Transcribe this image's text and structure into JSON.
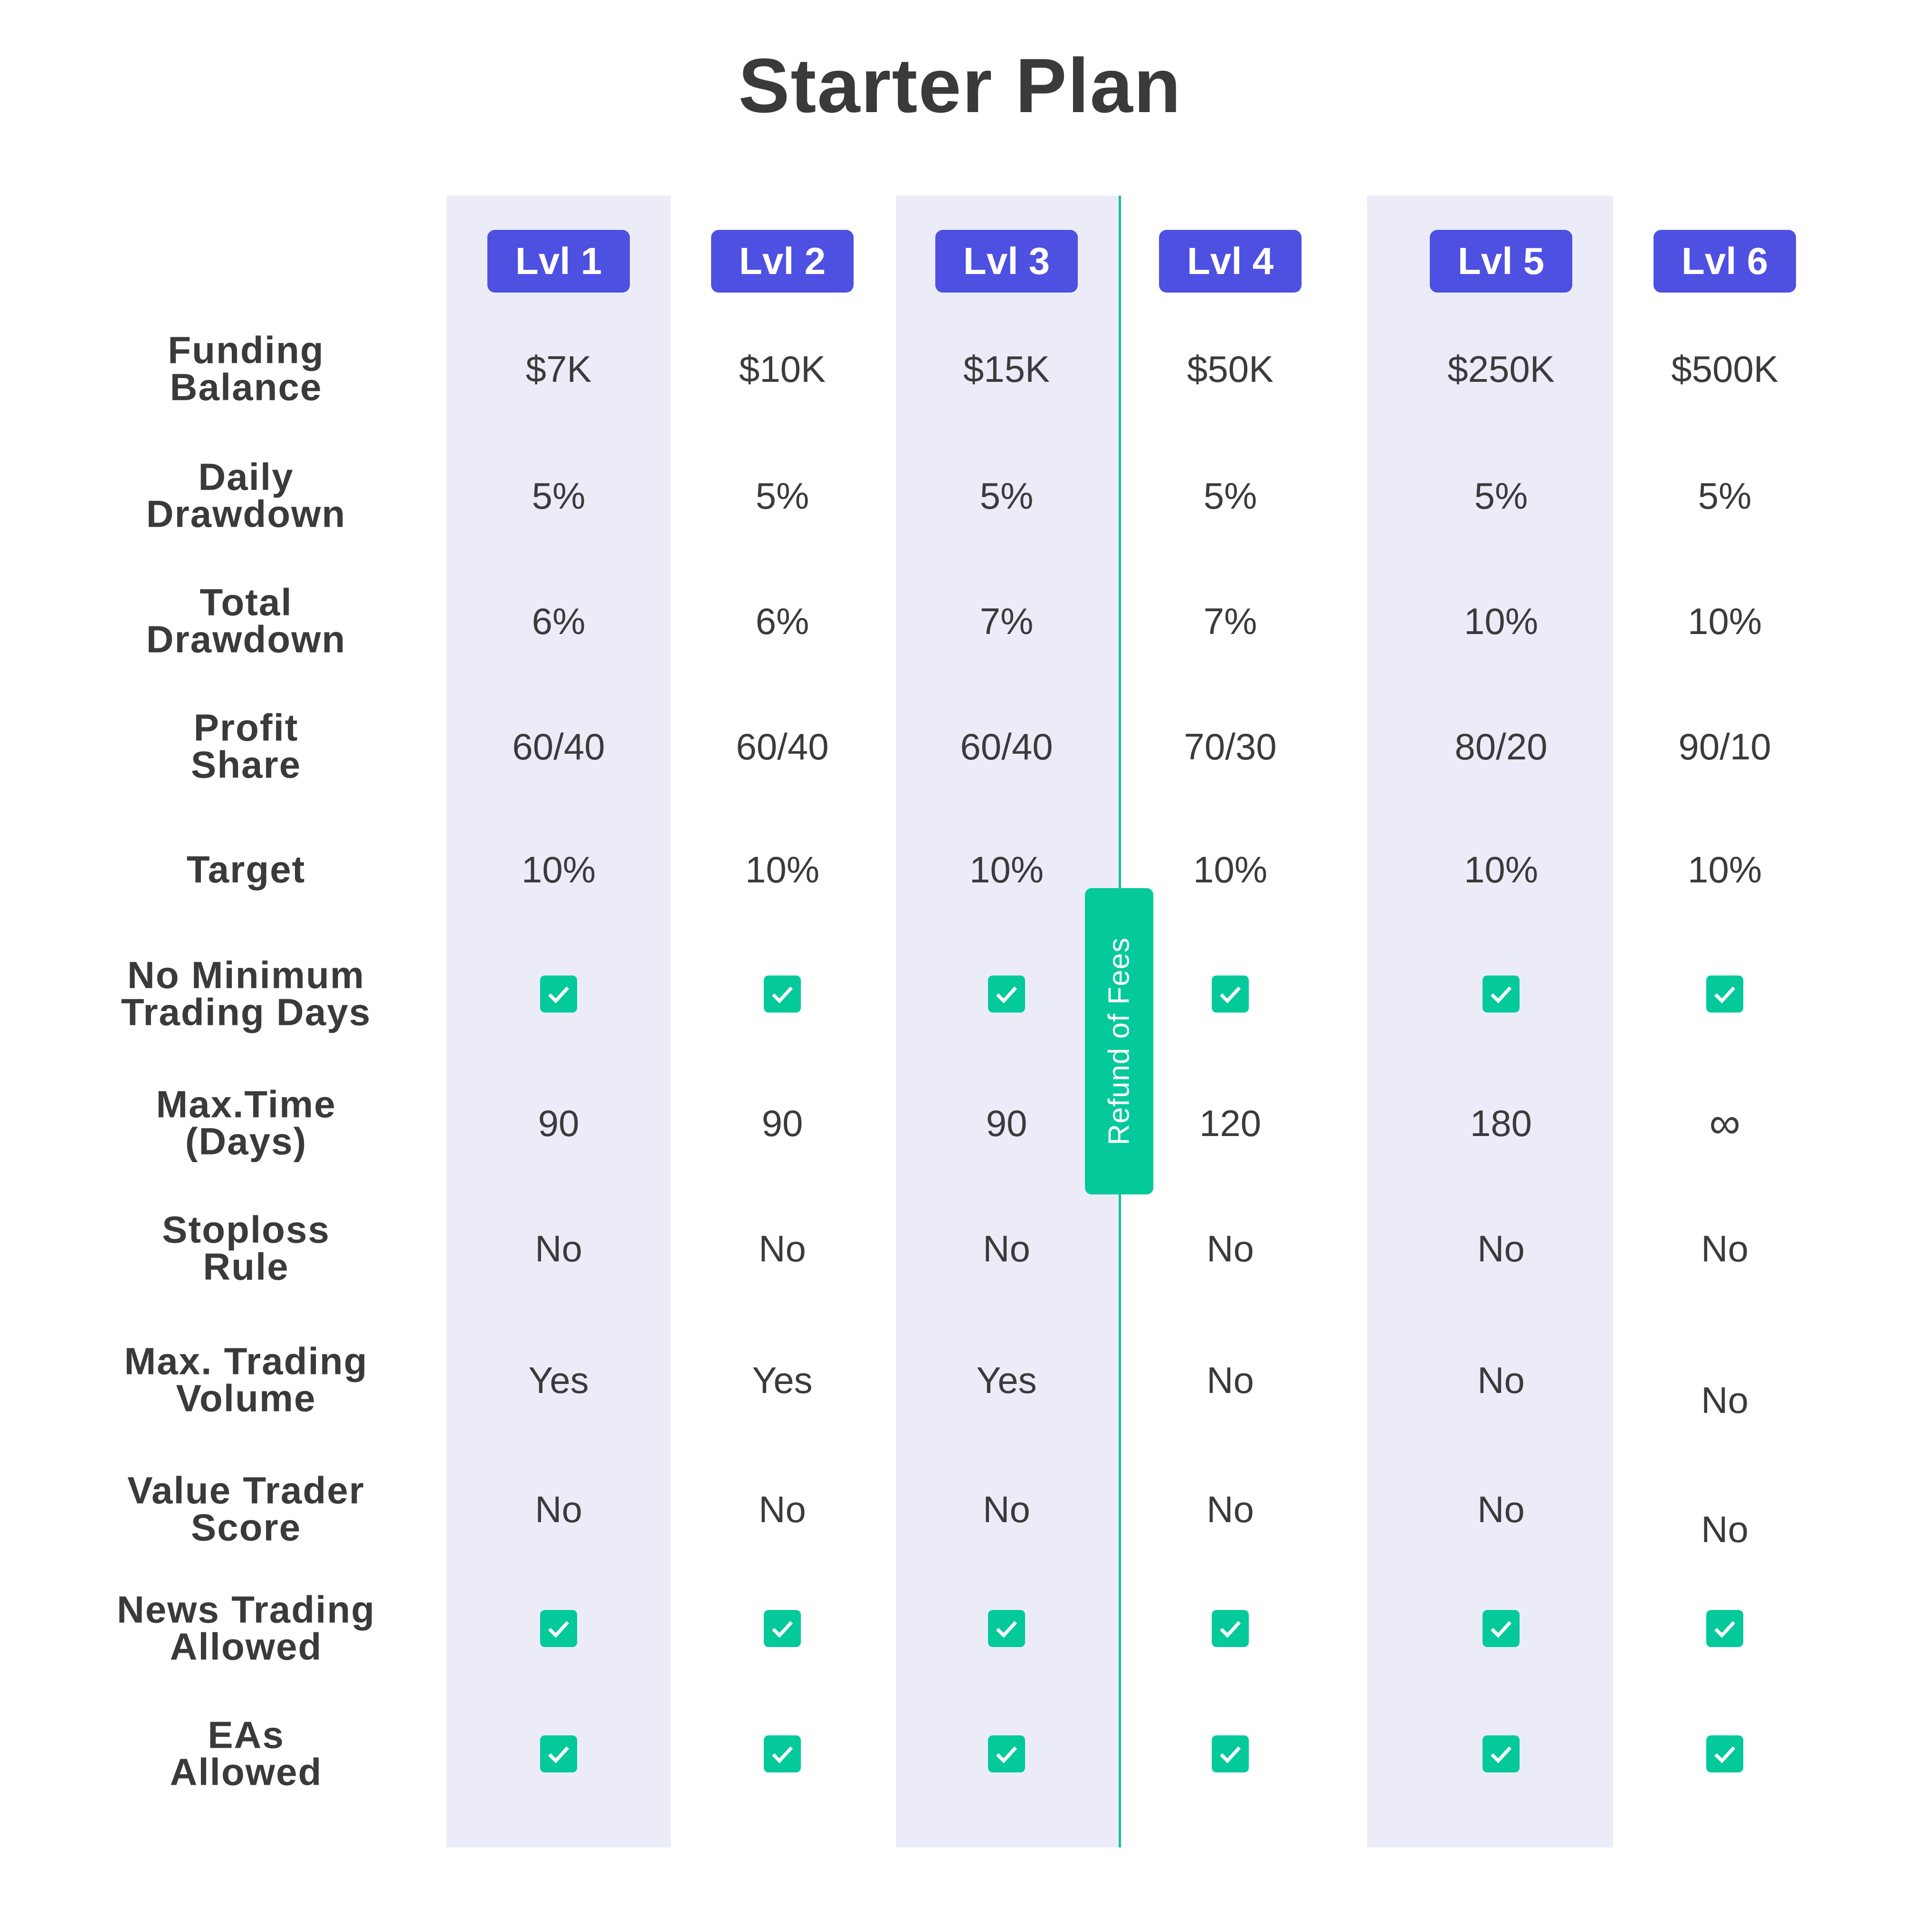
{
  "title": "Starter Plan",
  "colors": {
    "badge": "#4d50e0",
    "accent_green": "#04c99b",
    "column_shade": "#ececf9",
    "text": "#3b3b3b"
  },
  "levels": [
    "Lvl 1",
    "Lvl 2",
    "Lvl 3",
    "Lvl 4",
    "Lvl 5",
    "Lvl 6"
  ],
  "refund_badge": "Refund of Fees",
  "rows": [
    {
      "label": [
        "Funding",
        "Balance"
      ],
      "values": [
        "$7K",
        "$10K",
        "$15K",
        "$50K",
        "$250K",
        "$500K"
      ]
    },
    {
      "label": [
        "Daily",
        "Drawdown"
      ],
      "values": [
        "5%",
        "5%",
        "5%",
        "5%",
        "5%",
        "5%"
      ]
    },
    {
      "label": [
        "Total",
        "Drawdown"
      ],
      "values": [
        "6%",
        "6%",
        "7%",
        "7%",
        "10%",
        "10%"
      ]
    },
    {
      "label": [
        "Profit",
        "Share"
      ],
      "values": [
        "60/40",
        "60/40",
        "60/40",
        "70/30",
        "80/20",
        "90/10"
      ]
    },
    {
      "label": [
        "Target"
      ],
      "values": [
        "10%",
        "10%",
        "10%",
        "10%",
        "10%",
        "10%"
      ]
    },
    {
      "label": [
        "No Minimum",
        "Trading Days"
      ],
      "values": [
        "check",
        "check",
        "check",
        "check",
        "check",
        "check"
      ]
    },
    {
      "label": [
        "Max.Time",
        "(Days)"
      ],
      "values": [
        "90",
        "90",
        "90",
        "120",
        "180",
        "∞"
      ]
    },
    {
      "label": [
        "Stoploss",
        "Rule"
      ],
      "values": [
        "No",
        "No",
        "No",
        "No",
        "No",
        "No"
      ]
    },
    {
      "label": [
        "Max. Trading",
        "Volume"
      ],
      "values": [
        "Yes",
        "Yes",
        "Yes",
        "No",
        "No",
        "No"
      ]
    },
    {
      "label": [
        "Value Trader",
        "Score"
      ],
      "values": [
        "No",
        "No",
        "No",
        "No",
        "No",
        "No"
      ]
    },
    {
      "label": [
        "News Trading",
        "Allowed"
      ],
      "values": [
        "check",
        "check",
        "check",
        "check",
        "check",
        "check"
      ]
    },
    {
      "label": [
        "EAs",
        "Allowed"
      ],
      "values": [
        "check",
        "check",
        "check",
        "check",
        "check",
        "check"
      ]
    }
  ]
}
